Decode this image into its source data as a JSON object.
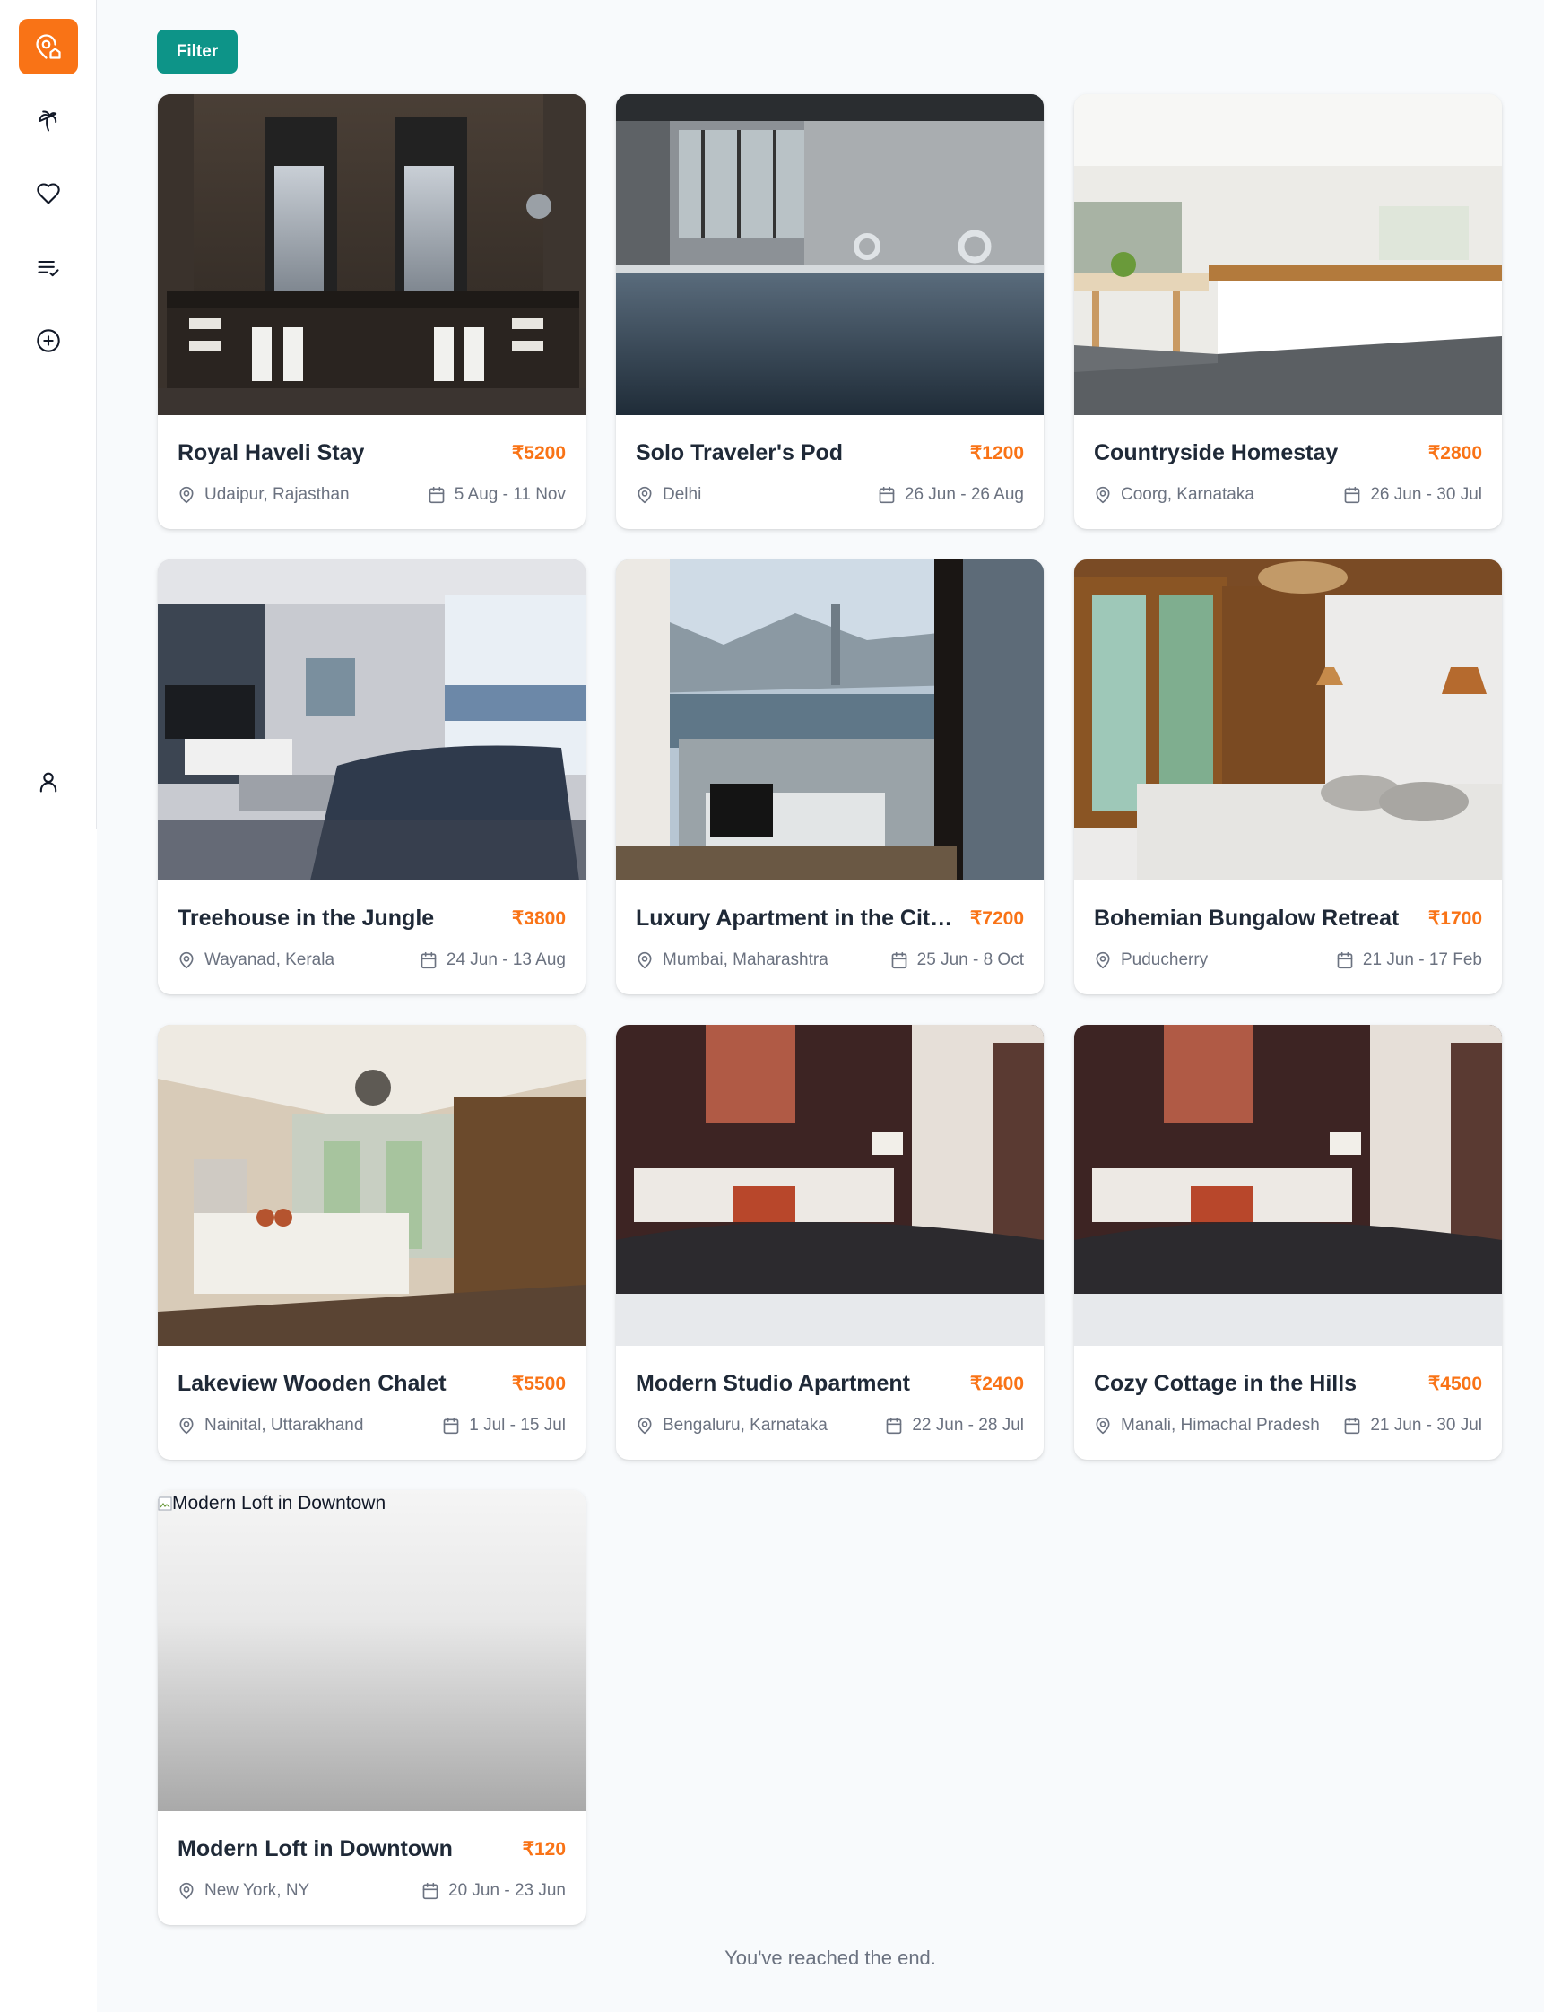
{
  "app": {
    "accent_color": "#f97316",
    "filter_color": "#0d9488"
  },
  "sidebar": {
    "logo_icon": "map-pin-home-icon",
    "items": [
      {
        "icon": "palm-tree-icon"
      },
      {
        "icon": "heart-icon"
      },
      {
        "icon": "checklist-icon"
      },
      {
        "icon": "plus-circle-icon"
      }
    ],
    "profile_icon": "user-icon"
  },
  "toolbar": {
    "filter_label": "Filter"
  },
  "listings": [
    {
      "title": "Royal Haveli Stay",
      "price": "₹5200",
      "location": "Udaipur, Rajasthan",
      "dates": "5 Aug - 11 Nov",
      "image_alt": "Royal Haveli Stay"
    },
    {
      "title": "Solo Traveler's Pod",
      "price": "₹1200",
      "location": "Delhi",
      "dates": "26 Jun - 26 Aug",
      "image_alt": "Solo Traveler's Pod"
    },
    {
      "title": "Countryside Homestay",
      "price": "₹2800",
      "location": "Coorg, Karnataka",
      "dates": "26 Jun - 30 Jul",
      "image_alt": "Countryside Homestay"
    },
    {
      "title": "Treehouse in the Jungle",
      "price": "₹3800",
      "location": "Wayanad, Kerala",
      "dates": "24 Jun - 13 Aug",
      "image_alt": "Treehouse in the Jungle"
    },
    {
      "title": "Luxury Apartment in the City Center",
      "price": "₹7200",
      "location": "Mumbai, Maharashtra",
      "dates": "25 Jun - 8 Oct",
      "image_alt": "Luxury Apartment in the City Center"
    },
    {
      "title": "Bohemian Bungalow Retreat",
      "price": "₹1700",
      "location": "Puducherry",
      "dates": "21 Jun - 17 Feb",
      "image_alt": "Bohemian Bungalow Retreat"
    },
    {
      "title": "Lakeview Wooden Chalet",
      "price": "₹5500",
      "location": "Nainital, Uttarakhand",
      "dates": "1 Jul - 15 Jul",
      "image_alt": "Lakeview Wooden Chalet"
    },
    {
      "title": "Modern Studio Apartment",
      "price": "₹2400",
      "location": "Bengaluru, Karnataka",
      "dates": "22 Jun - 28 Jul",
      "image_alt": "Modern Studio Apartment"
    },
    {
      "title": "Cozy Cottage in the Hills",
      "price": "₹4500",
      "location": "Manali, Himachal Pradesh",
      "dates": "21 Jun - 30 Jul",
      "image_alt": "Cozy Cottage in the Hills"
    },
    {
      "title": "Modern Loft in Downtown",
      "price": "₹120",
      "location": "New York, NY",
      "dates": "20 Jun - 23 Jun",
      "image_alt": "Modern Loft in Downtown"
    }
  ],
  "footer": {
    "end_message": "You've reached the end."
  }
}
